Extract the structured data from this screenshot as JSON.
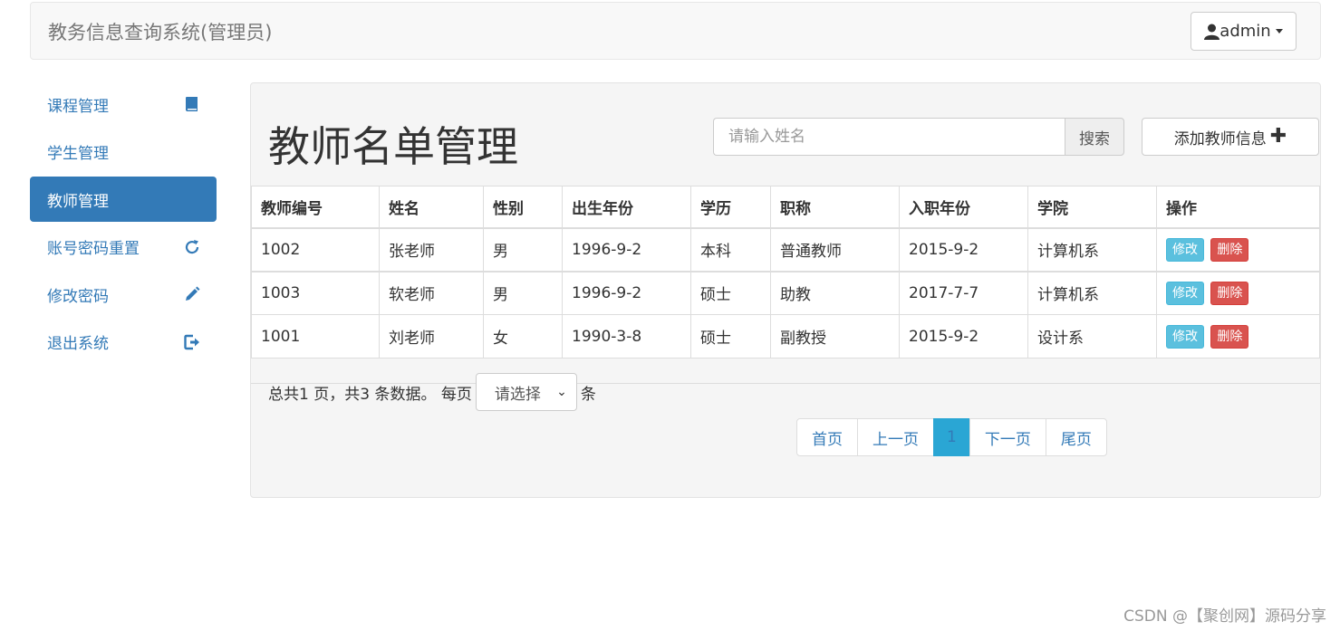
{
  "navbar": {
    "brand": "教务信息查询系统(管理员)",
    "user": "admin"
  },
  "sidebar": {
    "items": [
      {
        "label": "课程管理",
        "icon": "book-icon"
      },
      {
        "label": "学生管理",
        "icon": ""
      },
      {
        "label": "教师管理",
        "icon": "",
        "active": true
      },
      {
        "label": "账号密码重置",
        "icon": "refresh-icon"
      },
      {
        "label": "修改密码",
        "icon": "pencil-icon"
      },
      {
        "label": "退出系统",
        "icon": "logout-icon"
      }
    ]
  },
  "main": {
    "title": "教师名单管理",
    "search": {
      "placeholder": "请输入姓名",
      "button": "搜索"
    },
    "add_button": "添加教师信息",
    "table": {
      "headers": [
        "教师编号",
        "姓名",
        "性别",
        "出生年份",
        "学历",
        "职称",
        "入职年份",
        "学院",
        "操作"
      ],
      "rows": [
        [
          "1002",
          "张老师",
          "男",
          "1996-9-2",
          "本科",
          "普通教师",
          "2015-9-2",
          "计算机系"
        ],
        [
          "1003",
          "软老师",
          "男",
          "1996-9-2",
          "硕士",
          "助教",
          "2017-7-7",
          "计算机系"
        ],
        [
          "1001",
          "刘老师",
          "女",
          "1990-3-8",
          "硕士",
          "副教授",
          "2015-9-2",
          "设计系"
        ]
      ],
      "edit_label": "修改",
      "delete_label": "删除"
    },
    "pagination_info": {
      "text": "总共1 页，共3 条数据。 每页",
      "select_value": "请选择",
      "suffix": "条"
    },
    "pagination": {
      "first": "首页",
      "prev": "上一页",
      "current": "1",
      "next": "下一页",
      "last": "尾页"
    }
  },
  "watermark": "CSDN @【聚创网】源码分享",
  "colors": {
    "primary": "#337ab7",
    "info": "#5bc0de",
    "danger": "#d9534f"
  }
}
